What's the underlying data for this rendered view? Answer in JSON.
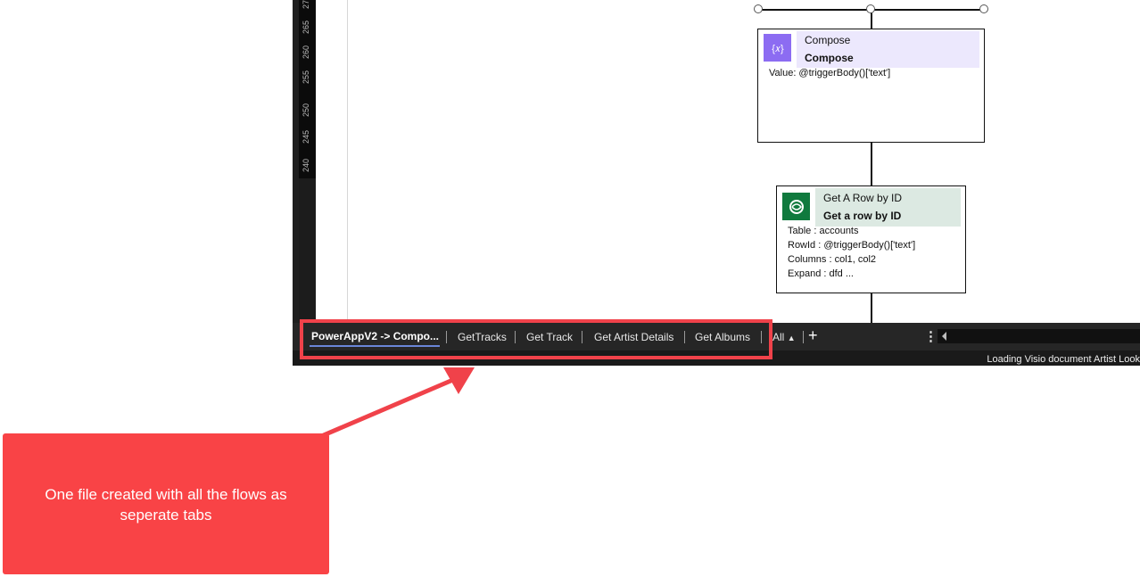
{
  "ruler": {
    "ticks": [
      "270",
      "265",
      "260",
      "255",
      "250",
      "245",
      "240"
    ]
  },
  "shapes": {
    "compose": {
      "title": "Compose",
      "subtitle": "Compose",
      "body": "Value: @triggerBody()['text']",
      "icon": "variable-braces-icon",
      "accent": "#8c6cf2",
      "header_bg": "#ece8fd"
    },
    "get_row": {
      "title": "Get A Row by ID",
      "subtitle": "Get a row by ID",
      "body": "Table : accounts\nRowId : @triggerBody()['text']\nColumns : col1, col2\nExpand : dfd ...",
      "icon": "dataverse-icon",
      "accent": "#107a3e",
      "header_bg": "#dce9e2"
    }
  },
  "tabs": [
    {
      "label": "PowerAppV2 -> Compo...",
      "active": true
    },
    {
      "label": "GetTracks",
      "active": false
    },
    {
      "label": "Get Track",
      "active": false
    },
    {
      "label": "Get Artist Details",
      "active": false
    },
    {
      "label": "Get Albums",
      "active": false
    }
  ],
  "tab_all": "All",
  "status": {
    "loading": "Loading Visio document Artist Look"
  },
  "callout": {
    "text": "One file created with all the flows as seperate tabs",
    "color": "#f94346"
  },
  "highlight_color": "#f0424a"
}
